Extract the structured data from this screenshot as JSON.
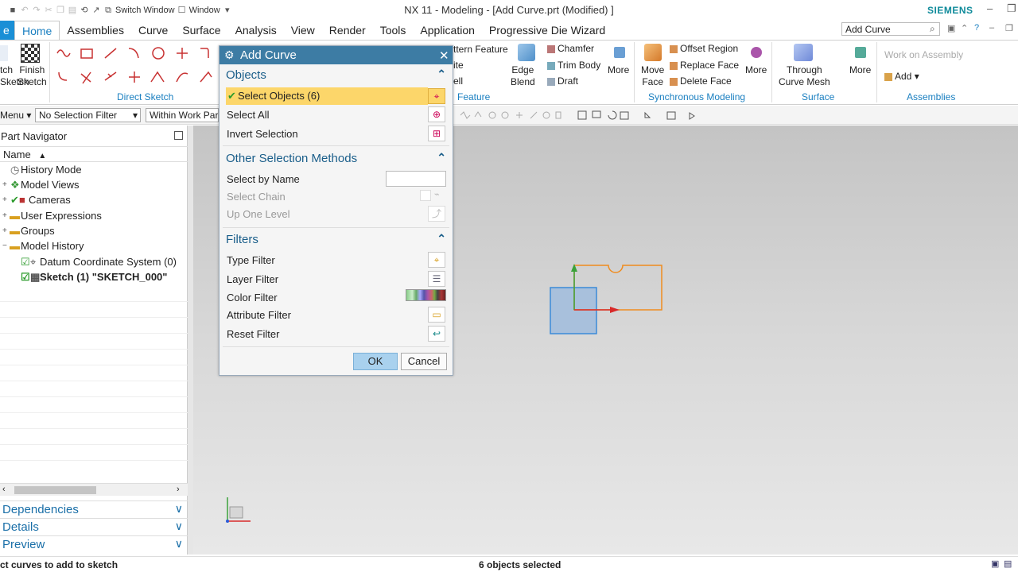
{
  "titlebar": {
    "switch_window": "Switch Window",
    "window_menu": "Window",
    "title": "NX 11 - Modeling - [Add Curve.prt (Modified) ]",
    "brand": "SIEMENS"
  },
  "menubar": {
    "file": "e",
    "tabs": [
      "Home",
      "Assemblies",
      "Curve",
      "Surface",
      "Analysis",
      "View",
      "Render",
      "Tools",
      "Application",
      "Progressive Die Wizard"
    ],
    "search_value": "Add Curve"
  },
  "ribbon": {
    "finish_sketch": [
      "Finish",
      "Sketch"
    ],
    "finish_left": [
      "tch",
      "Sketch"
    ],
    "direct_sketch": "Direct Sketch",
    "feature_items": [
      "ttern Feature",
      "ite",
      "ell"
    ],
    "feature_label": "Feature",
    "edge_blend": [
      "Edge",
      "Blend"
    ],
    "chamfer": "Chamfer",
    "trim_body": "Trim Body",
    "draft": "Draft",
    "more": "More",
    "move_face": [
      "Move",
      "Face"
    ],
    "offset_region": "Offset Region",
    "replace_face": "Replace Face",
    "delete_face": "Delete Face",
    "sync_label": "Synchronous Modeling",
    "through_curve_mesh": [
      "Through",
      "Curve Mesh"
    ],
    "surface_label": "Surface",
    "work_on_assembly": "Work on Assembly",
    "add": "Add",
    "assemblies_label": "Assemblies"
  },
  "toolbar2": {
    "menu": "Menu",
    "selection_filter": "No Selection Filter",
    "scope": "Within Work Par"
  },
  "navigator": {
    "title": "Part Navigator",
    "column": "Name",
    "rows": [
      {
        "label": "History Mode",
        "exp": ""
      },
      {
        "label": "Model Views",
        "exp": "+"
      },
      {
        "label": "Cameras",
        "exp": "+"
      },
      {
        "label": "User Expressions",
        "exp": "+"
      },
      {
        "label": "Groups",
        "exp": "+"
      },
      {
        "label": "Model History",
        "exp": "−"
      },
      {
        "label": "Datum Coordinate System (0)",
        "exp": ""
      },
      {
        "label": "Sketch (1) \"SKETCH_000\"",
        "exp": ""
      }
    ],
    "sections": [
      "Dependencies",
      "Details",
      "Preview"
    ]
  },
  "dialog": {
    "title": "Add Curve",
    "objects_section": "Objects",
    "select_objects": "Select Objects (6)",
    "select_all": "Select All",
    "invert_selection": "Invert Selection",
    "other_section": "Other Selection Methods",
    "select_by_name": "Select by Name",
    "select_chain": "Select Chain",
    "up_one_level": "Up One Level",
    "filters_section": "Filters",
    "type_filter": "Type Filter",
    "layer_filter": "Layer Filter",
    "color_filter": "Color Filter",
    "attribute_filter": "Attribute Filter",
    "reset_filter": "Reset Filter",
    "ok": "OK",
    "cancel": "Cancel"
  },
  "status": {
    "prompt": "ct curves to add to sketch",
    "selected": "6 objects selected"
  },
  "colors": {
    "accent": "#1a7fc0",
    "dialog_title": "#3d7ca4",
    "selected_row": "#fcd66a",
    "sketch_orange": "#f08c1e"
  }
}
